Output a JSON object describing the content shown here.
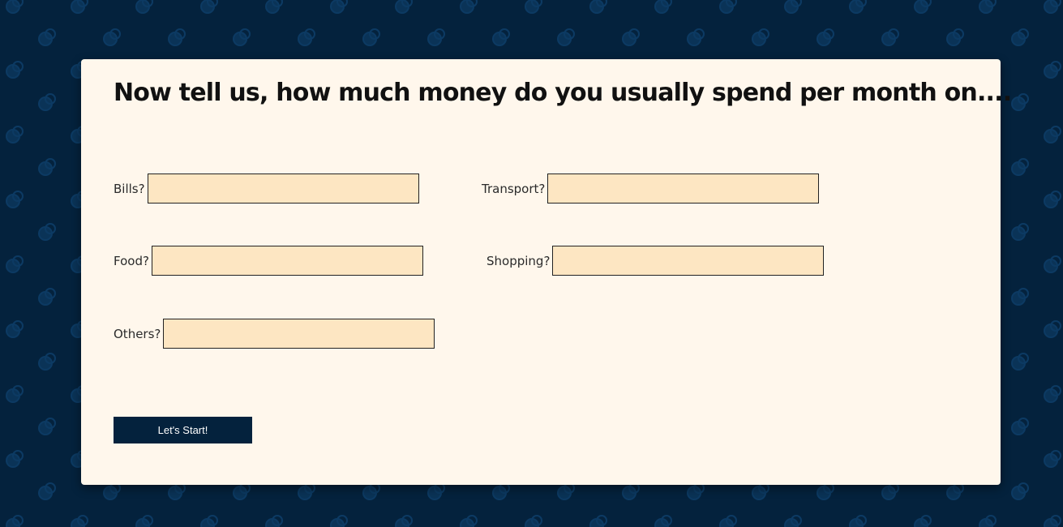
{
  "page": {
    "title": "Now tell us, how much money do you usually spend per month on...."
  },
  "fields": {
    "bills": {
      "label": "Bills?",
      "value": "",
      "placeholder": ""
    },
    "transport": {
      "label": "Transport?",
      "value": "",
      "placeholder": ""
    },
    "food": {
      "label": "Food?",
      "value": "",
      "placeholder": ""
    },
    "shopping": {
      "label": "Shopping?",
      "value": "",
      "placeholder": ""
    },
    "others": {
      "label": "Others?",
      "value": "",
      "placeholder": ""
    }
  },
  "actions": {
    "start_label": "Let's Start!"
  },
  "colors": {
    "background": "#04223d",
    "card": "#fff7ec",
    "input": "#fde6c2",
    "button": "#04223d"
  }
}
